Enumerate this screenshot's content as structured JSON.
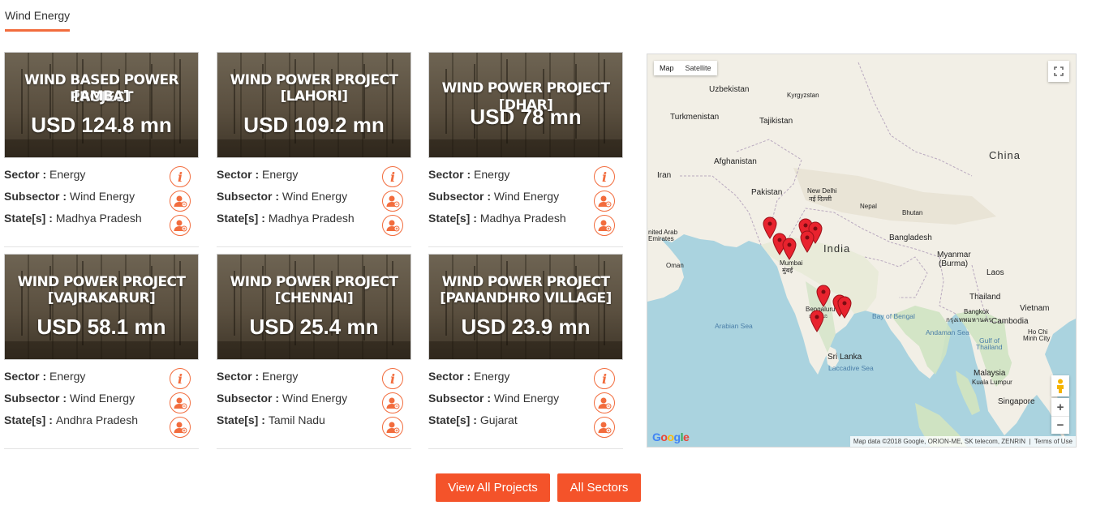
{
  "section": {
    "title": "Wind Energy"
  },
  "labels": {
    "sector": "Sector",
    "subsector": "Subsector",
    "states": "State[s]"
  },
  "projects": [
    {
      "title_line1": "WIND BASED POWER PROJECT",
      "title_line2": "[AMBA]",
      "value": "USD 124.8 mn",
      "sector": "Energy",
      "subsector": "Wind Energy",
      "state": "Madhya Pradesh"
    },
    {
      "title_line1": "WIND POWER PROJECT",
      "title_line2": "[LAHORI]",
      "value": "USD 109.2 mn",
      "sector": "Energy",
      "subsector": "Wind Energy",
      "state": "Madhya Pradesh"
    },
    {
      "title_line1": "WIND POWER PROJECT [DHAR]",
      "title_line2": "",
      "value": "USD 78 mn",
      "sector": "Energy",
      "subsector": "Wind Energy",
      "state": "Madhya Pradesh"
    },
    {
      "title_line1": "WIND POWER PROJECT",
      "title_line2": "[VAJRAKARUR]",
      "value": "USD 58.1 mn",
      "sector": "Energy",
      "subsector": "Wind Energy",
      "state": "Andhra Pradesh"
    },
    {
      "title_line1": "WIND POWER PROJECT",
      "title_line2": "[CHENNAI]",
      "value": "USD 25.4 mn",
      "sector": "Energy",
      "subsector": "Wind Energy",
      "state": "Tamil Nadu"
    },
    {
      "title_line1": "WIND POWER PROJECT",
      "title_line2": "[PANANDHRO VILLAGE]",
      "value": "USD 23.9 mn",
      "sector": "Energy",
      "subsector": "Wind Energy",
      "state": "Gujarat"
    }
  ],
  "map": {
    "type_map": "Map",
    "type_satellite": "Satellite",
    "countries": {
      "uzbekistan": "Uzbekistan",
      "kyrgyzstan": "Kyrgyzstan",
      "turkmenistan": "Turkmenistan",
      "tajikistan": "Tajikistan",
      "afghanistan": "Afghanistan",
      "iran": "Iran",
      "pakistan": "Pakistan",
      "china": "China",
      "nepal": "Nepal",
      "bhutan": "Bhutan",
      "india": "India",
      "bangladesh": "Bangladesh",
      "uae1": "nited Arab",
      "uae2": "Emirates",
      "oman": "Oman",
      "myanmar1": "Myanmar",
      "myanmar2": "(Burma)",
      "laos": "Laos",
      "thailand": "Thailand",
      "vietnam": "Vietnam",
      "cambodia": "Cambodia",
      "srilanka": "Sri Lanka",
      "malaysia": "Malaysia",
      "singapore": "Singapore"
    },
    "cities": {
      "newdelhi1": "New Delhi",
      "newdelhi2": "नई दिल्ली",
      "mumbai1": "Mumbai",
      "mumbai2": "मुंबई",
      "bengaluru1": "Bengaluru",
      "bengaluru2": "ಬೆಂಗಳೂ",
      "bangkok1": "Bangkok",
      "bangkok2": "กรุงเทพมหานคร",
      "hochiminh1": "Ho Chi",
      "hochiminh2": "Minh City",
      "kualalumpur": "Kuala Lumpur"
    },
    "seas": {
      "arabian": "Arabian Sea",
      "bengal": "Bay of Bengal",
      "andaman": "Andaman Sea",
      "thailand1": "Gulf of",
      "thailand2": "Thailand",
      "laccadive": "Laccadive Sea"
    },
    "google": "Google",
    "attribution": "Map data ©2018 Google, ORION-ME, SK telecom, ZENRIN",
    "terms": "Terms of Use",
    "zoom_in": "+",
    "zoom_out": "−",
    "colors": {
      "land": "#f2efe6",
      "water": "#aad3df",
      "green": "#cfe3c2",
      "marker": "#e8232e"
    }
  },
  "buttons": {
    "view_all_projects": "View All Projects",
    "all_sectors": "All Sectors"
  },
  "colors": {
    "accent": "#f26c3d",
    "button": "#f4532a"
  }
}
